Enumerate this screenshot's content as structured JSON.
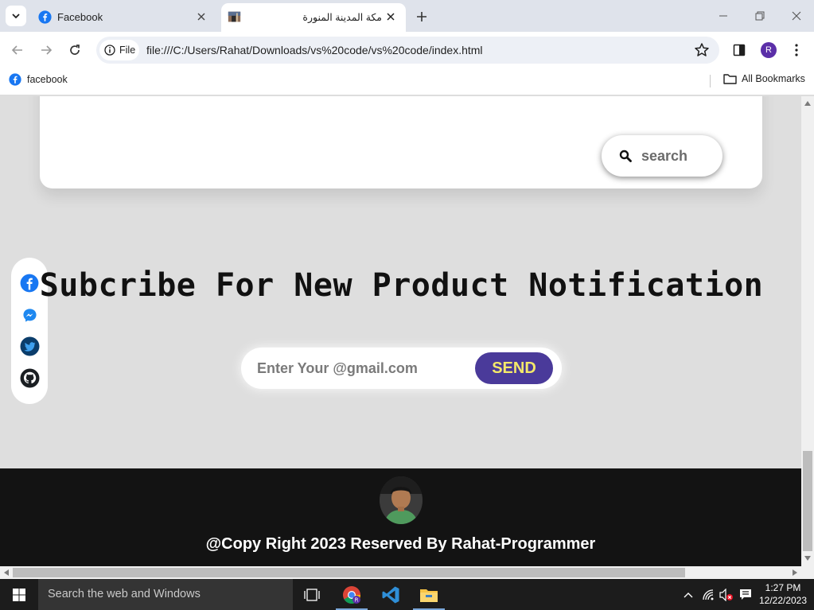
{
  "browser": {
    "tabs": [
      {
        "title": "Facebook",
        "active": false
      },
      {
        "title": "مكة المدينة المنورة",
        "active": true
      }
    ],
    "address": {
      "scheme_label": "File",
      "url": "file:///C:/Users/Rahat/Downloads/vs%20code/vs%20code/index.html"
    },
    "profile_initial": "R",
    "bookmarks": [
      {
        "label": "facebook"
      }
    ],
    "all_bookmarks_label": "All Bookmarks"
  },
  "page": {
    "search_label": "search",
    "social_icons": [
      "facebook-icon",
      "messenger-icon",
      "twitter-icon",
      "github-icon"
    ],
    "subscribe_heading": "Subcribe For New Product Notification",
    "email_placeholder": "Enter Your @gmail.com",
    "send_label": "SEND",
    "footer_text": "@Copy Right 2023 Reserved By Rahat-Programmer"
  },
  "taskbar": {
    "search_placeholder": "Search the web and Windows",
    "time": "1:27 PM",
    "date": "12/22/2023"
  },
  "colors": {
    "send_button_bg": "#4a3a9a",
    "send_button_text": "#f4e96a",
    "footer_bg": "#131313",
    "page_bg": "#dedede"
  }
}
